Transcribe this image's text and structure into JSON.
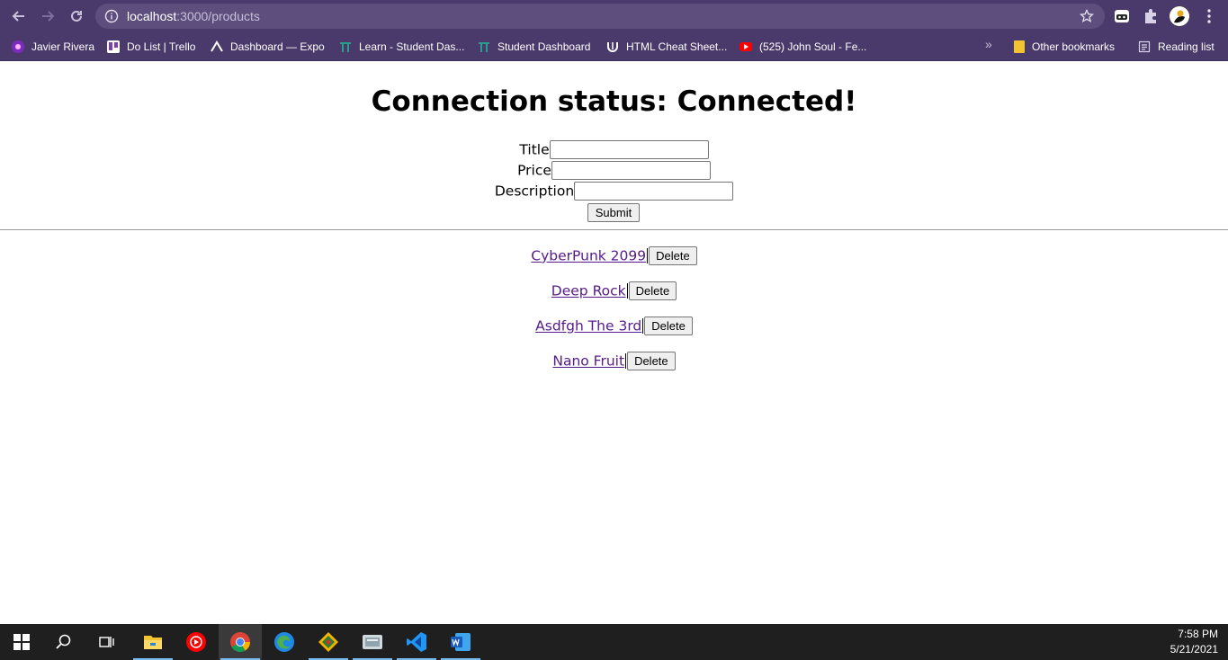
{
  "browser": {
    "url_host": "localhost",
    "url_rest": ":3000/products",
    "bookmarks": [
      {
        "label": "Javier Rivera",
        "icon": "twitch-icon"
      },
      {
        "label": "Do List | Trello",
        "icon": "trello-icon"
      },
      {
        "label": "Dashboard — Expo",
        "icon": "expo-icon"
      },
      {
        "label": "Learn - Student Das...",
        "icon": "gate-icon"
      },
      {
        "label": "Student Dashboard",
        "icon": "gate-icon"
      },
      {
        "label": "HTML Cheat Sheet...",
        "icon": "unicorn-icon"
      },
      {
        "label": "(525) John Soul - Fe...",
        "icon": "youtube-icon"
      }
    ],
    "other_bookmarks": "Other bookmarks",
    "reading_list": "Reading list"
  },
  "page": {
    "heading": "Connection status: Connected!",
    "form": {
      "title_label": "Title",
      "price_label": "Price",
      "description_label": "Description",
      "submit_label": "Submit"
    },
    "products": [
      {
        "name": "CyberPunk 2099",
        "delete_label": "Delete"
      },
      {
        "name": "Deep Rock",
        "delete_label": "Delete"
      },
      {
        "name": "Asdfgh The 3rd",
        "delete_label": "Delete"
      },
      {
        "name": "Nano Fruit",
        "delete_label": "Delete"
      }
    ]
  },
  "taskbar": {
    "apps": [
      "start-icon",
      "search-icon",
      "task-view-icon",
      "file-explorer-icon",
      "youtube-music-icon",
      "chrome-icon",
      "edge-icon",
      "gitkraken-icon",
      "app-icon",
      "vscode-icon",
      "word-icon"
    ],
    "time": "7:58 PM",
    "date": "5/21/2021"
  },
  "colors": {
    "chrome_bg": "#4a3a6b",
    "link": "#551a8b",
    "taskbar_bg": "#1f1f1f"
  }
}
